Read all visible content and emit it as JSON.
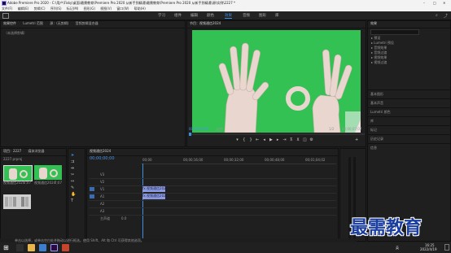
{
  "app": {
    "title": "Adobe Premiere Pro 2020 - C:\\用户\\Fisky\\桌面\\最需教育\\Premiere Pro 2020 从新手到精通\\最需教育\\Premiere Pro 2020 从新手到精通\\源\\实例\\2227 *",
    "window_controls": [
      "–",
      "□",
      "✕"
    ]
  },
  "menu": [
    "文件(F)",
    "编辑(E)",
    "剪辑(C)",
    "序列(S)",
    "标记(M)",
    "图形(G)",
    "视图(V)",
    "窗口(W)",
    "帮助(H)"
  ],
  "workspaces": [
    "学习",
    "组件",
    "编辑",
    "颜色",
    "效果",
    "音频",
    "图形",
    "库"
  ],
  "active_workspace": "效果",
  "source_panel": {
    "tabs": [
      "效果控件",
      "Lumetri 范围",
      "源：(无剪辑)",
      "音频剪辑混合器"
    ],
    "placeholder": "（未选择剪辑）"
  },
  "program_panel": {
    "title": "节目：视频通信2024",
    "timecode_left": "00;00;00;00",
    "fit": "适合",
    "quality": "1/2",
    "timecode_right": "00;00;07;07"
  },
  "effects_panel": {
    "title": "效果",
    "items": [
      "预设",
      "Lumetri 预设",
      "音频效果",
      "音频过渡",
      "视频效果",
      "视频过渡"
    ],
    "sections": [
      "基本图形",
      "基本声音",
      "Lumetri 颜色",
      "库",
      "标记",
      "历史记录",
      "信息"
    ]
  },
  "project_panel": {
    "tabs": [
      "项目：2227",
      "媒体浏览器"
    ],
    "file": "2227.prproj",
    "clips": [
      {
        "name": "视频通信2024",
        "duration": "7;07"
      },
      {
        "name": "视频通信2024",
        "duration": "7;07"
      },
      {
        "name": "",
        "duration": ""
      }
    ]
  },
  "timeline": {
    "tab": "视频通信2024",
    "timecode": "00;00;00;00",
    "ruler": [
      "00;00",
      "00;00;16;00",
      "00;00;32;00",
      "00;00;48;00",
      "00;01;04;02"
    ],
    "video_tracks": [
      "V3",
      "V2",
      "V1"
    ],
    "audio_tracks": [
      "A1",
      "A2",
      "A3"
    ],
    "master": "主声道",
    "master_value": "0.0",
    "clip_video": "fx 视频通信2024",
    "clip_audio": "fx 视频通信2024"
  },
  "status_bar": "单击以选择，或单击空白处并拖动以进行框选。使用 Shift、Alt 和 Ctrl 可获得其他选项。",
  "watermark": "最需教育",
  "taskbar": {
    "time": "16:25",
    "date": "2022/4/19",
    "lang": "英"
  },
  "colors": {
    "accent": "#3a8ee6",
    "green_screen": "#33c153",
    "clip_blue": "#8b9be0",
    "watermark_blue": "#1a3d9e"
  }
}
